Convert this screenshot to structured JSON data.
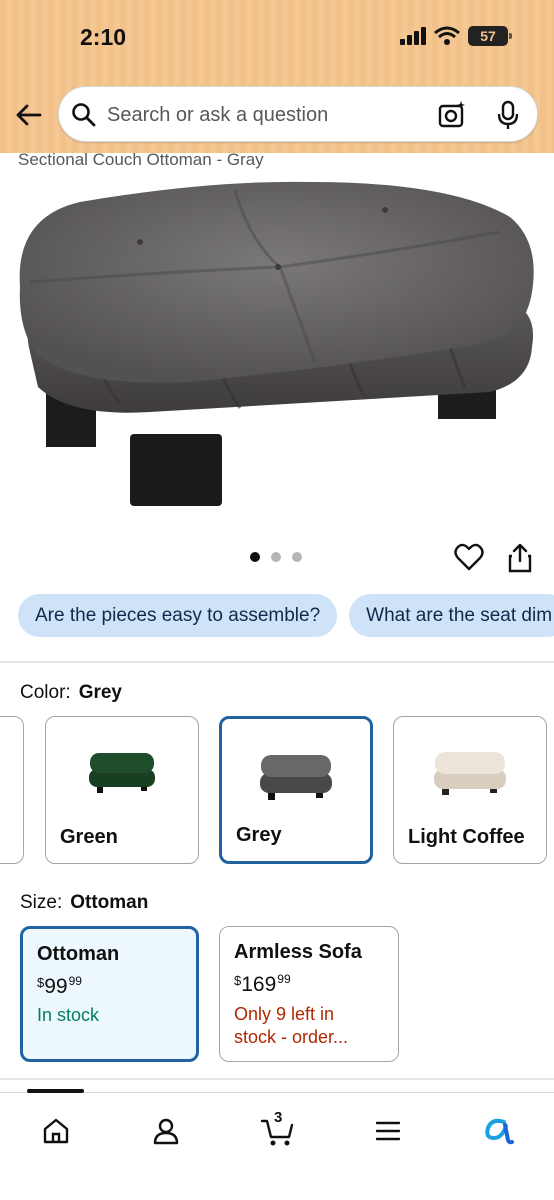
{
  "status_bar": {
    "time": "2:10",
    "battery": "57"
  },
  "search": {
    "placeholder": "Search or ask a question"
  },
  "product": {
    "title": "Sectional Couch Ottoman - Gray",
    "image_count": 3,
    "active_image": 1
  },
  "questions": [
    "Are the pieces easy to assemble?",
    "What are the seat dim"
  ],
  "color": {
    "label": "Color:",
    "selected": "Grey",
    "options": [
      {
        "name": "Green",
        "tone": "#1f4d2b"
      },
      {
        "name": "Grey",
        "tone": "#5d5b5c"
      },
      {
        "name": "Light Coffee",
        "tone": "#e7ddd0"
      }
    ]
  },
  "size": {
    "label": "Size:",
    "selected": "Ottoman",
    "options": [
      {
        "name": "Ottoman",
        "currency": "$",
        "price_whole": "99",
        "price_fraction": "99",
        "stock": "In stock"
      },
      {
        "name": "Armless Sofa",
        "currency": "$",
        "price_whole": "169",
        "price_fraction": "99",
        "stock_line1": "Only 9 left in",
        "stock_line2": "stock - order..."
      }
    ]
  },
  "nav": {
    "cart_count": "3"
  },
  "colors": {
    "header": "#f2c18a",
    "accent_blue": "#2162a1",
    "chip_bg": "#cfe3f8",
    "in_stock_green": "#067d62",
    "low_stock_red": "#b12704"
  }
}
